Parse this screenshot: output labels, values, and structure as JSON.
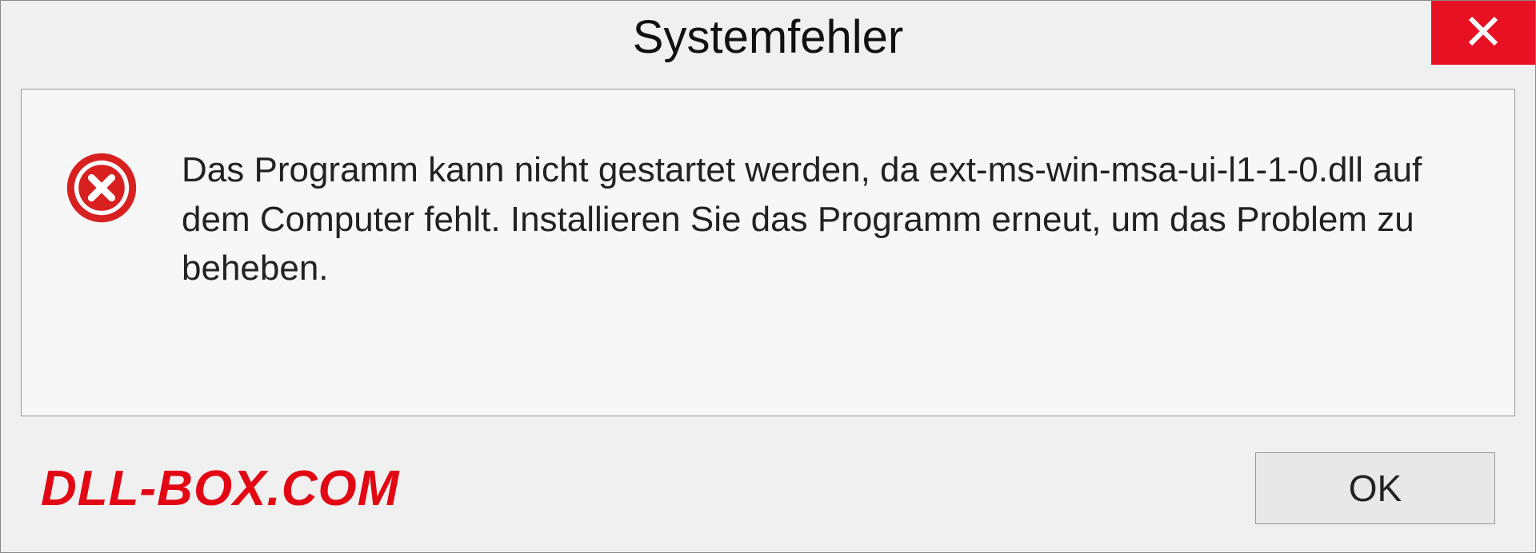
{
  "titlebar": {
    "title": "Systemfehler"
  },
  "content": {
    "message": "Das Programm kann nicht gestartet werden, da ext-ms-win-msa-ui-l1-1-0.dll auf dem Computer fehlt. Installieren Sie das Programm erneut, um das Problem zu beheben."
  },
  "footer": {
    "watermark": "DLL-BOX.COM",
    "ok_label": "OK"
  },
  "colors": {
    "close_button_bg": "#e81123",
    "error_icon_red": "#d92020",
    "watermark_red": "#e30613"
  }
}
